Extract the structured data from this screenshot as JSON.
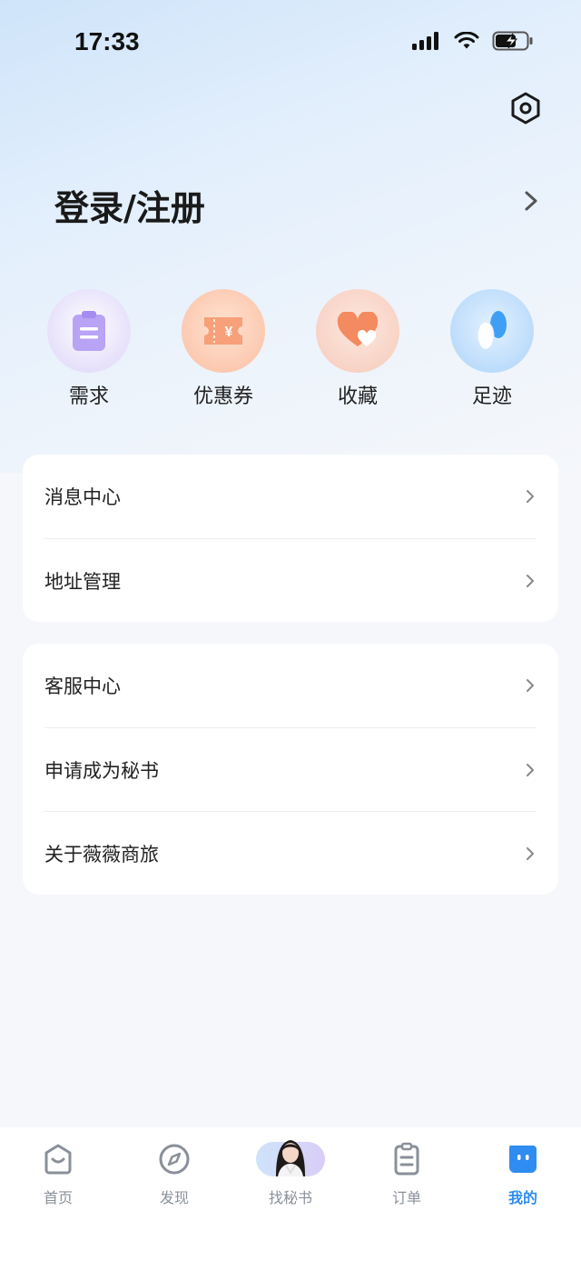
{
  "status_bar": {
    "time": "17:33"
  },
  "header": {
    "login_label": "登录/注册"
  },
  "quick_actions": [
    {
      "label": "需求",
      "icon": "clipboard-icon",
      "color": "#b9a3f5"
    },
    {
      "label": "优惠券",
      "icon": "coupon-icon",
      "color": "#f7a07a"
    },
    {
      "label": "收藏",
      "icon": "heart-icon",
      "color": "#f48a5f"
    },
    {
      "label": "足迹",
      "icon": "footprint-icon",
      "color": "#3f9ff5"
    }
  ],
  "menu_group_1": [
    {
      "label": "消息中心"
    },
    {
      "label": "地址管理"
    }
  ],
  "menu_group_2": [
    {
      "label": "客服中心"
    },
    {
      "label": "申请成为秘书"
    },
    {
      "label": "关于薇薇商旅"
    }
  ],
  "tabbar": {
    "tabs": [
      {
        "label": "首页",
        "icon": "home-icon"
      },
      {
        "label": "发现",
        "icon": "compass-icon"
      },
      {
        "label": "找秘书",
        "icon": "secretary-avatar"
      },
      {
        "label": "订单",
        "icon": "order-list-icon"
      },
      {
        "label": "我的",
        "icon": "profile-face-icon",
        "active": true
      }
    ],
    "active_color": "#2f8cf0"
  }
}
